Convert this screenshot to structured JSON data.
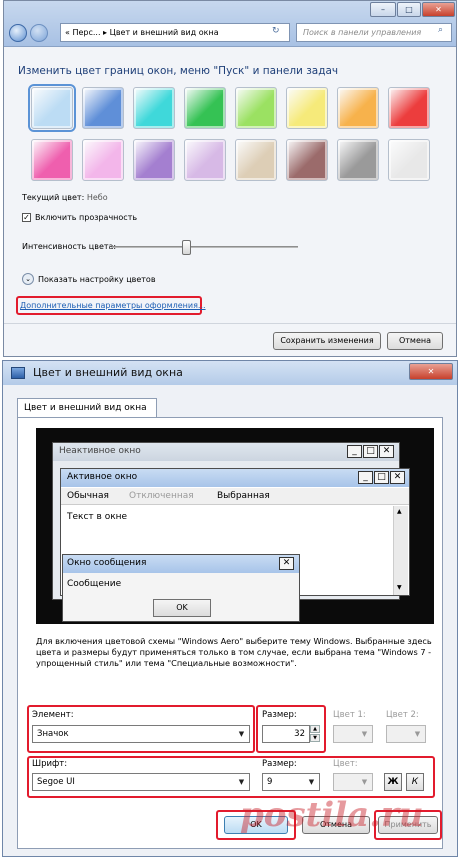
{
  "top_window": {
    "address_chevrons": "«",
    "address_part1": "Перс...",
    "address_sep": "▸",
    "address_part2": "Цвет и внешний вид окна",
    "search_placeholder": "Поиск в панели управления",
    "heading": "Изменить цвет границ окон, меню \"Пуск\" и панели задач",
    "swatches": [
      {
        "color": "#bcdcf4",
        "selected": true
      },
      {
        "color": "#5f8fd8"
      },
      {
        "color": "#3fd8da"
      },
      {
        "color": "#35c254"
      },
      {
        "color": "#9be162"
      },
      {
        "color": "#f6ea7a"
      },
      {
        "color": "#f7b24c"
      },
      {
        "color": "#ec3d3d"
      },
      {
        "color": "#ef5fae"
      },
      {
        "color": "#f3b6ea"
      },
      {
        "color": "#a47fd0"
      },
      {
        "color": "#d7b9e6"
      },
      {
        "color": "#ddceb6"
      },
      {
        "color": "#9b6b6b"
      },
      {
        "color": "#9a9a9a"
      },
      {
        "color": "#e8e8e8"
      }
    ],
    "current_color_label": "Текущий цвет:",
    "current_color_value": "Небо",
    "transparency_label": "Включить прозрачность",
    "transparency_checked": "✓",
    "intensity_label": "Интенсивность цвета:",
    "intensity_level": 0.4,
    "mixer_label": "Показать настройку цветов",
    "advanced_link": "Дополнительные параметры оформления...",
    "save_button": "Сохранить изменения",
    "cancel_button": "Отмена"
  },
  "dialog": {
    "title": "Цвет и внешний вид окна",
    "close_glyph": "✕",
    "tab": "Цвет и внешний вид окна",
    "preview": {
      "inactive_title": "Неактивное окно",
      "active_title": "Активное окно",
      "menu_normal": "Обычная",
      "menu_disabled": "Отключенная",
      "menu_selected": "Выбранная",
      "window_text": "Текст в окне",
      "msgbox_title": "Окно сообщения",
      "msgbox_text": "Сообщение",
      "msgbox_ok": "OK"
    },
    "description": "Для включения цветовой схемы \"Windows Aero\" выберите тему Windows. Выбранные здесь цвета и размеры будут применяться только в том случае, если выбрана тема \"Windows 7 - упрощенный стиль\" или тема \"Специальные возможности\".",
    "element_label": "Элемент:",
    "element_value": "Значок",
    "size_label": "Размер:",
    "size_value": "32",
    "color1_label": "Цвет 1:",
    "color2_label": "Цвет 2:",
    "font_label": "Шрифт:",
    "font_value": "Segoe UI",
    "font_size_label": "Размер:",
    "font_size_value": "9",
    "font_color_label": "Цвет:",
    "bold_label": "Ж",
    "italic_label": "К",
    "ok_button": "OK",
    "cancel_button": "Отмена",
    "apply_button": "Применить"
  },
  "watermark": "postila.ru",
  "colors": {
    "accent_red": "#e21b2d",
    "link": "#1e5fb4",
    "heading": "#1e3f78"
  }
}
